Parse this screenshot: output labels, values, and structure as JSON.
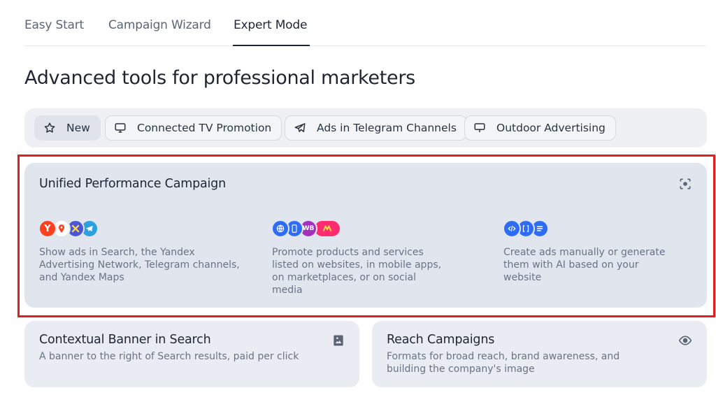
{
  "tabs": [
    {
      "label": "Easy Start"
    },
    {
      "label": "Campaign Wizard"
    },
    {
      "label": "Expert Mode",
      "active": true
    }
  ],
  "page_title": "Advanced tools for professional marketers",
  "chips": [
    {
      "label": "New",
      "icon": "star-icon",
      "selected": true
    },
    {
      "label": "Connected TV Promotion",
      "icon": "monitor-icon"
    },
    {
      "label": "Ads in Telegram Channels",
      "icon": "telegram-icon"
    },
    {
      "label": "Outdoor Advertising",
      "icon": "billboard-icon"
    }
  ],
  "unified_card": {
    "title": "Unified Performance Campaign",
    "columns": [
      {
        "icons": [
          "yandex-icon",
          "maps-pin-icon",
          "network-icon",
          "telegram-icon"
        ],
        "description": "Show ads in Search, the Yandex Advertising Network, Telegram channels, and Yandex Maps"
      },
      {
        "icons": [
          "website-icon",
          "mobile-app-icon",
          "wildberries-icon",
          "marketplace-icon"
        ],
        "badge": "WB",
        "description": "Promote products and services listed on websites, in mobile apps, on marketplaces, or on social media"
      },
      {
        "icons": [
          "code-icon",
          "frame-icon",
          "list-icon"
        ],
        "description": "Create ads manually or generate them with AI based on your website"
      }
    ]
  },
  "banner_card": {
    "title": "Contextual Banner in Search",
    "description": "A banner to the right of Search results, paid per click",
    "icon": "image-icon"
  },
  "reach_card": {
    "title": "Reach Campaigns",
    "description": "Formats for broad reach, brand awareness, and building the company's image",
    "icon": "eye-icon"
  },
  "colors": {
    "accent_red": "#e01e1e",
    "icon_blue": "#2f6cf6",
    "text_primary": "#1f2633",
    "text_secondary": "#6a7385"
  }
}
